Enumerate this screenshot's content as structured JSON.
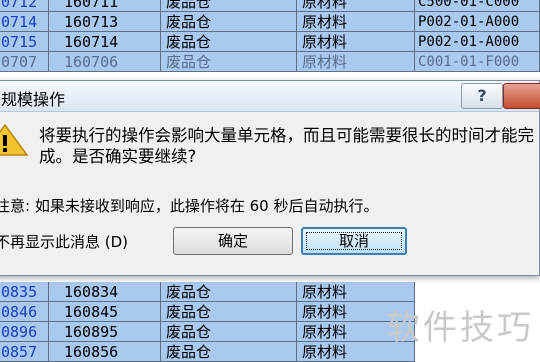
{
  "sheet": {
    "rows_top": [
      [
        "0712",
        "160711",
        "废品仓",
        "原材料",
        "C500-01-C000"
      ],
      [
        "0714",
        "160713",
        "废品仓",
        "原材料",
        "P002-01-A000"
      ],
      [
        "0715",
        "160714",
        "废品仓",
        "原材料",
        "P002-01-A000"
      ],
      [
        "0707",
        "160706",
        "废品仓",
        "原材料",
        "C001-01-F000"
      ]
    ],
    "rows_bottom": [
      [
        "0835",
        "160834",
        "废品仓",
        "原材料"
      ],
      [
        "0846",
        "160845",
        "废品仓",
        "原材料"
      ],
      [
        "0896",
        "160895",
        "废品仓",
        "原材料"
      ],
      [
        "0857",
        "160856",
        "废品仓",
        "原材料"
      ]
    ],
    "cell_color": "#a9c9ee"
  },
  "dialog": {
    "title": "规模操作",
    "help_label": "?",
    "message": "将要执行的操作会影响大量单元格，而且可能需要很长的时间才能完成。是否确实要继续?",
    "notice": "注意: 如果未接收到响应，此操作将在 60 秒后自动执行。",
    "checkbox_label": "不再显示此消息 (D)",
    "confirm_label": "确定",
    "cancel_label": "取消",
    "icon": "warning-icon"
  },
  "watermark": "软件技巧"
}
